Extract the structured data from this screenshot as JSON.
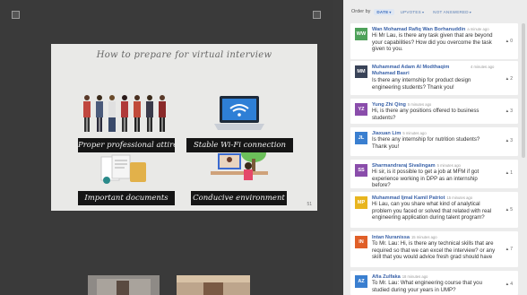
{
  "slide": {
    "title": "How to prepare for virtual interview",
    "labels": [
      "Proper professional attire",
      "Stable Wi-Fi connection",
      "Important documents",
      "Conducive environment"
    ],
    "page_number": "51"
  },
  "qa": {
    "sort": {
      "label": "Order by",
      "options": [
        "DATE",
        "UPVOTES",
        "NOT ANSWERED"
      ],
      "active_index": 0
    },
    "questions": [
      {
        "initials": "WW",
        "color": "#4ea15a",
        "name": "Wan Mohamad Rafiq Wan Borhanuddin",
        "time": "a minute ago",
        "text": "Hi Mr Lau, is there any task given that are beyond your capabilities? How did you overcome the task given to you.",
        "votes": "0"
      },
      {
        "initials": "MM",
        "color": "#394358",
        "name": "Muhammad Adam Al Modthaqim Muhamad Basri",
        "time": "4 minutes ago",
        "text": "Is there any internship for product design engineering students? Thank you!",
        "votes": "2"
      },
      {
        "initials": "YZ",
        "color": "#8a4dab",
        "name": "Yung Zhi Qing",
        "time": "5 minutes ago",
        "text": "Hi, is there any positions offered to business students?",
        "votes": "3"
      },
      {
        "initials": "JL",
        "color": "#3a7fd0",
        "name": "Jiaxuan Lim",
        "time": "5 minutes ago",
        "text": "Is there any internship for nutrition students? Thank you!",
        "votes": "3"
      },
      {
        "initials": "SS",
        "color": "#8a4dab",
        "name": "Sharmandraraj Sivalingam",
        "time": "5 minutes ago",
        "text": "Hi sir, is it possible to get a job at MFM if got experience working in DPP as an internship before?",
        "votes": "1"
      },
      {
        "initials": "MP",
        "color": "#e8b51f",
        "name": "Muhammad Ijmal Kamil Patriot",
        "time": "15 minutes ago",
        "text": "Hi Lau, can you share what kind of analytical problem you faced or solved that related with real engineering application during talent program?",
        "votes": "5"
      },
      {
        "initials": "IN",
        "color": "#e05f28",
        "name": "Intan Nuranissa",
        "time": "15 minutes ago",
        "text": "To Mr. Lau: Hi, is there any technical skills that are required so that we can excel the interview? or any skill that you would advice fresh grad should have",
        "votes": "7"
      },
      {
        "initials": "AZ",
        "color": "#3a7fd0",
        "name": "Afia Zulfaka",
        "time": "18 minutes ago",
        "text": "To Mr. Lau: What engineering course that you studied during your years in UMP?",
        "votes": "4"
      }
    ]
  }
}
